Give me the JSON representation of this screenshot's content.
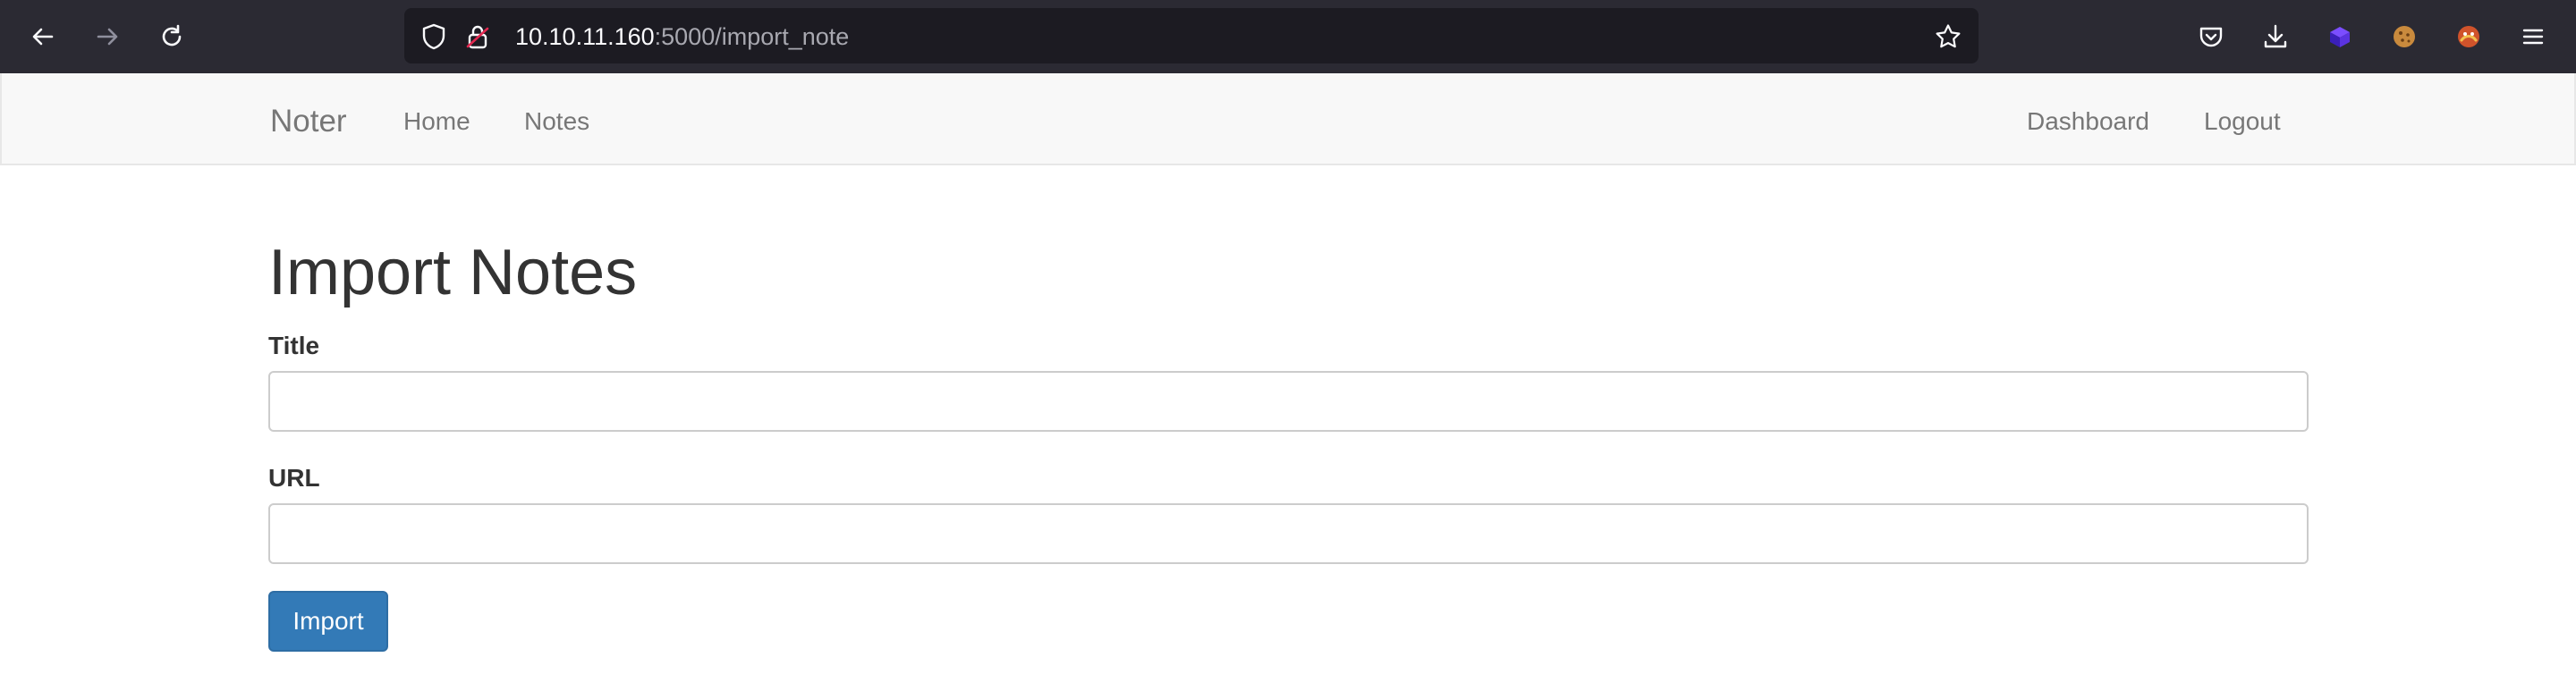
{
  "browser": {
    "url_host": "10.10.11.160",
    "url_rest": ":5000/import_note",
    "icons": {
      "back": "back-arrow-icon",
      "forward": "forward-arrow-icon",
      "reload": "reload-icon",
      "tracking": "shield-icon",
      "connection": "insecure-lock-icon",
      "bookmark": "star-icon",
      "pocket": "pocket-icon",
      "downloads": "download-icon",
      "extension1": "extension-cube-icon",
      "extension2": "cookie-icon",
      "extension3": "foxy-extension-icon",
      "menu": "hamburger-menu-icon"
    }
  },
  "navbar": {
    "brand": "Noter",
    "left_links": [
      "Home",
      "Notes"
    ],
    "right_links": [
      "Dashboard",
      "Logout"
    ]
  },
  "main": {
    "title": "Import Notes",
    "fields": [
      {
        "label": "Title",
        "value": ""
      },
      {
        "label": "URL",
        "value": ""
      }
    ],
    "submit_label": "Import"
  },
  "colors": {
    "chrome_bg": "#2b2a33",
    "urlbar_bg": "#1c1b22",
    "navbar_bg": "#f8f8f8",
    "primary_button": "#337ab7",
    "text": "#333333",
    "nav_text": "#777777"
  }
}
